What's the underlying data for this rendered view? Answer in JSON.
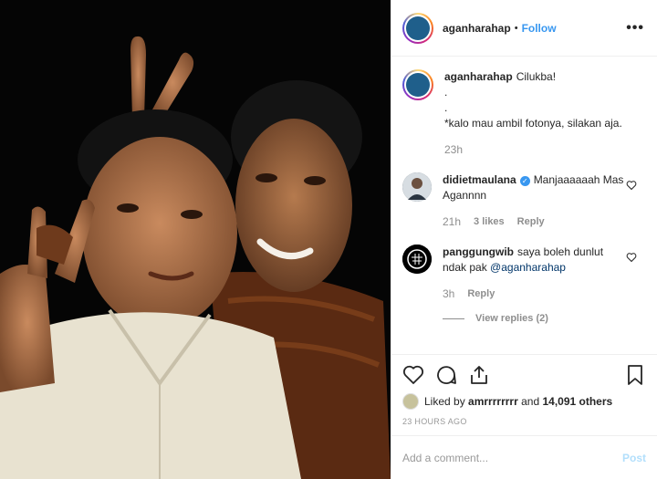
{
  "post": {
    "username": "aganharahap",
    "separator": "•",
    "follow_label": "Follow",
    "more_label": "•••",
    "caption": {
      "username": "aganharahap",
      "text": "Cilukba!",
      "line2": ".",
      "line3": ".",
      "line4": "*kalo mau ambil fotonya, silakan aja.",
      "time": "23h"
    }
  },
  "comments": [
    {
      "username": "didietmaulana",
      "verified": "✓",
      "text": "Manjaaaaaah Mas Agannnn",
      "time": "21h",
      "likes": "3 likes",
      "reply": "Reply"
    },
    {
      "username": "panggungwib",
      "text": "saya boleh dunlut ndak pak",
      "mention": "@aganharahap",
      "time": "3h",
      "reply": "Reply",
      "view_replies": "View replies (2)"
    }
  ],
  "actions": {
    "liked_by_prefix": "Liked by",
    "liked_by_user": "amrrrrrrrr",
    "liked_by_and": "and",
    "liked_by_count": "14,091 others",
    "date": "23 HOURS AGO"
  },
  "add_comment": {
    "placeholder": "Add a comment...",
    "post_label": "Post"
  },
  "colors": {
    "accent": "#3897f0",
    "post_disabled": "#b2dffc",
    "muted": "#8e8e8e"
  }
}
